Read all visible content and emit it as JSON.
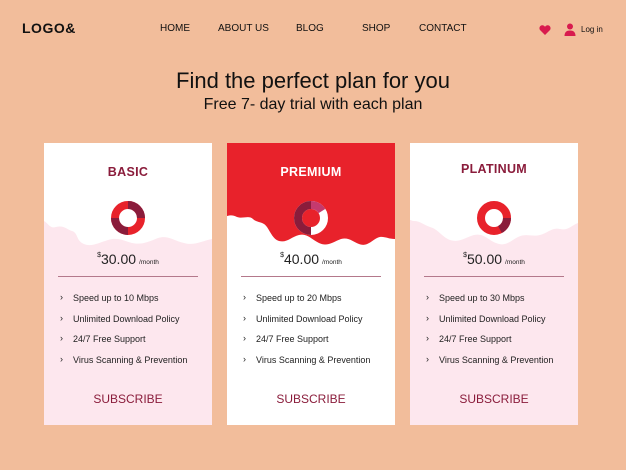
{
  "header": {
    "logo": "LOGO&",
    "nav": [
      {
        "label": "HOME"
      },
      {
        "label": "ABOUT US"
      },
      {
        "label": "BLOG"
      },
      {
        "label": "SHOP"
      },
      {
        "label": "CONTACT"
      }
    ],
    "heart_icon": "heart-icon",
    "user_icon": "user-icon",
    "login_label": "Log in"
  },
  "hero": {
    "title": "Find the perfect plan for you",
    "subtitle": "Free 7- day trial with each plan"
  },
  "plans": [
    {
      "name": "BASIC",
      "currency": "$",
      "price": "30.00",
      "period": "/month",
      "features": [
        "Speed up to 10 Mbps",
        "Unlimited Download Policy",
        "24/7 Free Support",
        "Virus Scanning & Prevention"
      ],
      "cta": "SUBSCRIBE"
    },
    {
      "name": "PREMIUM",
      "currency": "$",
      "price": "40.00",
      "period": "/month",
      "features": [
        "Speed up to 20 Mbps",
        "Unlimited Download Policy",
        "24/7 Free Support",
        "Virus Scanning & Prevention"
      ],
      "cta": "SUBSCRIBE"
    },
    {
      "name": "PLATINUM",
      "currency": "$",
      "price": "50.00",
      "period": "/month",
      "features": [
        "Speed up to 30 Mbps",
        "Unlimited Download Policy",
        "24/7 Free Support",
        "Virus Scanning & Prevention"
      ],
      "cta": "SUBSCRIBE"
    }
  ],
  "colors": {
    "background": "#f2bd9b",
    "card_pink": "#fde7ee",
    "accent_red": "#e8222b",
    "dark_red": "#8a1c3b",
    "heart": "#d81b4e"
  }
}
